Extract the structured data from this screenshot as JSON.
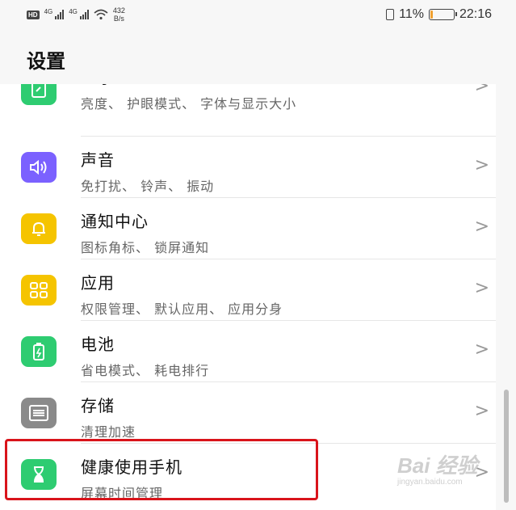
{
  "status_bar": {
    "hd_badge": "HD",
    "signal1_label": "4G",
    "signal2_label": "4G",
    "speed_value": "432",
    "speed_unit": "B/s",
    "battery_percent_text": "11%",
    "battery_level": 0.11,
    "time": "22:16"
  },
  "header": {
    "title": "设置"
  },
  "settings_items": [
    {
      "title": "显示",
      "subtitle": "亮度、 护眼模式、 字体与显示大小",
      "icon": "display-icon",
      "color": "#2ecc71"
    },
    {
      "title": "声音",
      "subtitle": "免打扰、 铃声、 振动",
      "icon": "sound-icon",
      "color": "#7b61ff"
    },
    {
      "title": "通知中心",
      "subtitle": "图标角标、 锁屏通知",
      "icon": "bell-icon",
      "color": "#f5c400"
    },
    {
      "title": "应用",
      "subtitle": "权限管理、 默认应用、 应用分身",
      "icon": "apps-icon",
      "color": "#f5c400"
    },
    {
      "title": "电池",
      "subtitle": "省电模式、 耗电排行",
      "icon": "battery-icon",
      "color": "#2ecc71"
    },
    {
      "title": "存储",
      "subtitle": "清理加速",
      "icon": "storage-icon",
      "color": "#8a8a8a"
    },
    {
      "title": "健康使用手机",
      "subtitle": "屏幕时间管理",
      "icon": "hourglass-icon",
      "color": "#2ecc71"
    }
  ],
  "chevron_glyph": ">",
  "watermark": {
    "main": "Bai 经验",
    "sub": "jingyan.baidu.com"
  }
}
